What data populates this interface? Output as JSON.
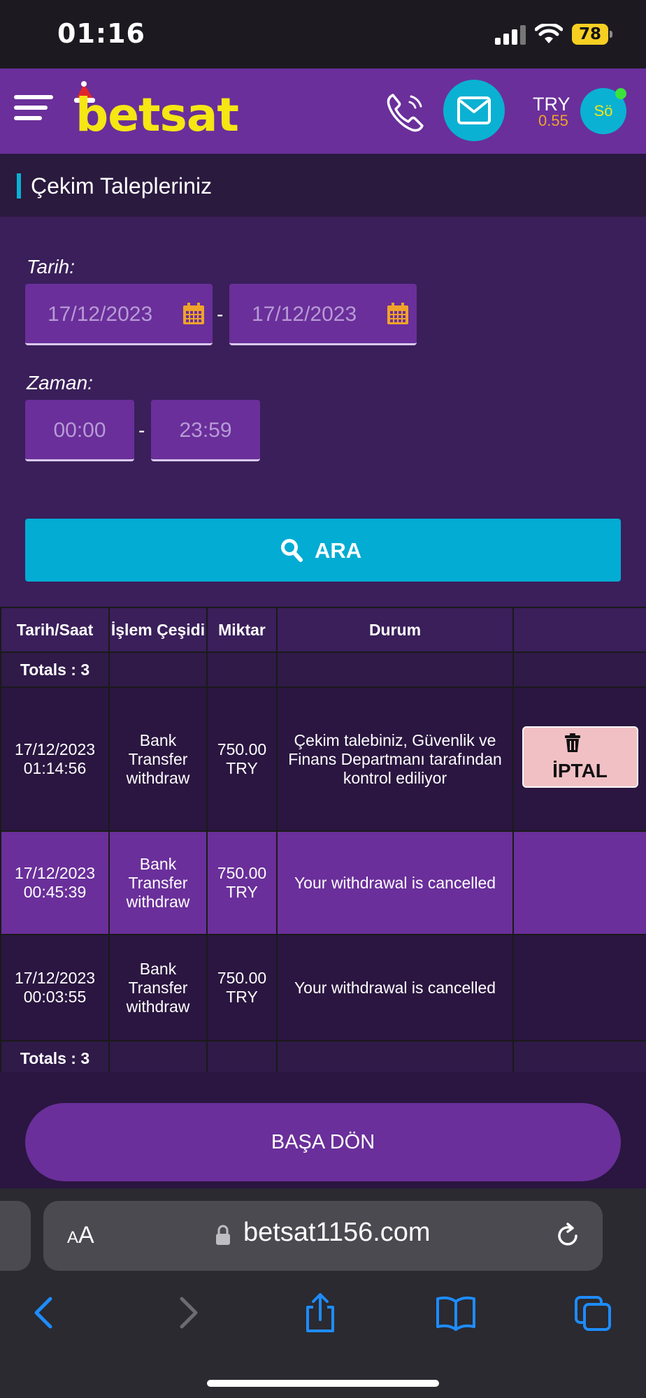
{
  "status_bar": {
    "time": "01:16",
    "battery": "78"
  },
  "header": {
    "logo": "betsat",
    "currency": "TRY",
    "balance": "0.55",
    "avatar": "Sö"
  },
  "page": {
    "title": "Çekim Talepleriniz"
  },
  "filters": {
    "date_label": "Tarih:",
    "date_from": "17/12/2023",
    "date_to": "17/12/2023",
    "time_label": "Zaman:",
    "time_from": "00:00",
    "time_to": "23:59",
    "separator": "-",
    "search_label": "ARA"
  },
  "table": {
    "headers": [
      "Tarih/Saat",
      "İşlem Çeşidi",
      "Miktar",
      "Durum",
      ""
    ],
    "totals": "Totals : 3",
    "rows": [
      {
        "datetime": "17/12/2023 01:14:56",
        "type": "Bank Transfer withdraw",
        "amount": "750.00 TRY",
        "status": "Çekim talebiniz, Güvenlik ve Finans Departmanı tarafından kontrol ediliyor",
        "action": "İPTAL"
      },
      {
        "datetime": "17/12/2023 00:45:39",
        "type": "Bank Transfer withdraw",
        "amount": "750.00 TRY",
        "status": "Your withdrawal is cancelled",
        "action": ""
      },
      {
        "datetime": "17/12/2023 00:03:55",
        "type": "Bank Transfer withdraw",
        "amount": "750.00 TRY",
        "status": "Your withdrawal is cancelled",
        "action": ""
      }
    ]
  },
  "back_to_top": "BAŞA DÖN",
  "browser": {
    "aa_label": "AA",
    "url": "betsat1156.com"
  },
  "colors": {
    "brand_purple": "#6a2f9a",
    "accent_cyan": "#02acd3",
    "logo_yellow": "#f5e614",
    "cancel_pink": "#f1c0c5"
  },
  "icons": [
    "menu-icon",
    "phone-icon",
    "mail-icon",
    "calendar-icon",
    "search-icon",
    "trash-icon",
    "lock-icon",
    "reload-icon",
    "back-icon",
    "forward-icon",
    "share-icon",
    "bookmarks-icon",
    "tabs-icon"
  ]
}
